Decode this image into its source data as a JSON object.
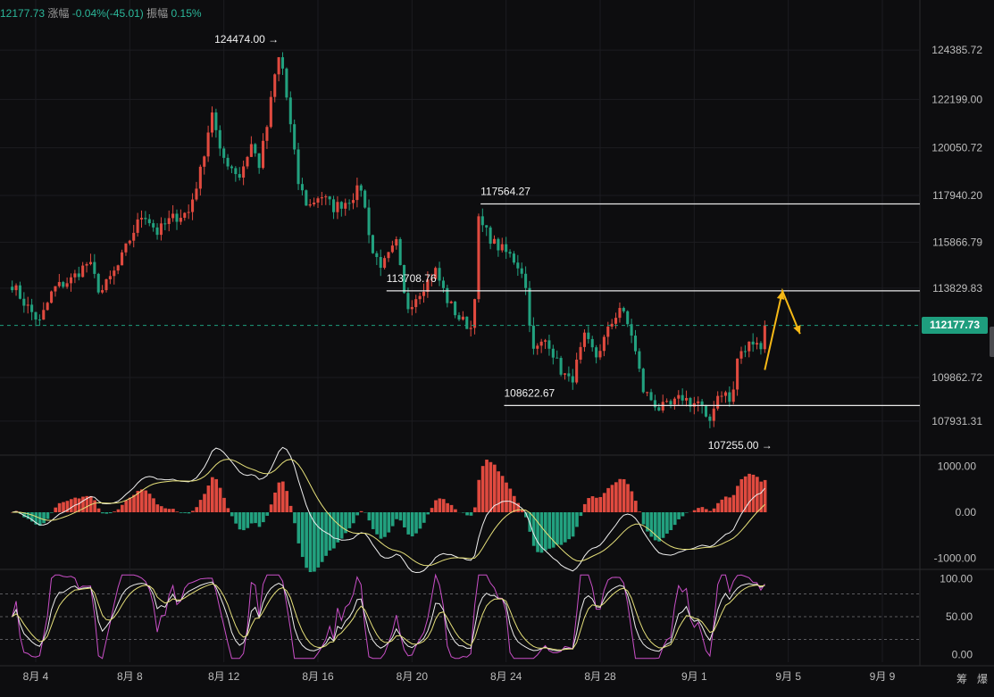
{
  "header": {
    "last_price": "12177.73",
    "change_label": "涨幅",
    "change_value": "-0.04%(-45.01)",
    "amplitude_label": "振幅",
    "amplitude_value": "0.15%"
  },
  "current_price_tag": "112177.73",
  "bottom_right": {
    "left": "筹",
    "right": "爆"
  },
  "colors": {
    "up": "#e04a3f",
    "down": "#22a17f",
    "background": "#0d0d0f",
    "grid": "#1c1c20",
    "accent_arrow": "#f5b816",
    "price_tag": "#1e9e7e",
    "stoch_k": "#c94fc7",
    "stoch_d": "#e6e07a"
  },
  "chart_data": [
    {
      "type": "candlestick",
      "panel": "price",
      "x_ticks": [
        "8月 4",
        "8月 8",
        "8月 12",
        "8月 16",
        "8月 20",
        "8月 24",
        "8月 28",
        "9月 1",
        "9月 5",
        "9月 9"
      ],
      "y_ticks": [
        124385.72,
        122199.0,
        120050.72,
        117940.2,
        115866.79,
        113829.83,
        109862.72,
        107931.31
      ],
      "ylim": [
        106500,
        125500
      ],
      "xlim_days": [
        "Aug 3",
        "Sep 10"
      ],
      "keypoints": [
        {
          "t": "Aug 3 00:00",
          "p": 114000
        },
        {
          "t": "Aug 3 12:00",
          "p": 113200
        },
        {
          "t": "Aug 4 04:00",
          "p": 112300
        },
        {
          "t": "Aug 4 18:00",
          "p": 113800
        },
        {
          "t": "Aug 5 12:00",
          "p": 114200
        },
        {
          "t": "Aug 6 06:00",
          "p": 115000
        },
        {
          "t": "Aug 6 18:00",
          "p": 113600
        },
        {
          "t": "Aug 7 12:00",
          "p": 114800
        },
        {
          "t": "Aug 8 02:00",
          "p": 116200
        },
        {
          "t": "Aug 8 14:00",
          "p": 117200
        },
        {
          "t": "Aug 9 04:00",
          "p": 116300
        },
        {
          "t": "Aug 9 18:00",
          "p": 116900
        },
        {
          "t": "Aug 10 12:00",
          "p": 117200
        },
        {
          "t": "Aug 11 00:00",
          "p": 119000
        },
        {
          "t": "Aug 11 12:00",
          "p": 121700
        },
        {
          "t": "Aug 11 20:00",
          "p": 119800
        },
        {
          "t": "Aug 12 16:00",
          "p": 118800
        },
        {
          "t": "Aug 13 04:00",
          "p": 120200
        },
        {
          "t": "Aug 13 12:00",
          "p": 119300
        },
        {
          "t": "Aug 13 20:00",
          "p": 121000
        },
        {
          "t": "Aug 14 06:00",
          "p": 123800
        },
        {
          "t": "Aug 14 10:00",
          "p": 124200
        },
        {
          "t": "Aug 14 20:00",
          "p": 121000
        },
        {
          "t": "Aug 15 04:00",
          "p": 118500
        },
        {
          "t": "Aug 15 14:00",
          "p": 117400
        },
        {
          "t": "Aug 16 02:00",
          "p": 118000
        },
        {
          "t": "Aug 16 16:00",
          "p": 117400
        },
        {
          "t": "Aug 17 06:00",
          "p": 117700
        },
        {
          "t": "Aug 17 20:00",
          "p": 118300
        },
        {
          "t": "Aug 18 08:00",
          "p": 115400
        },
        {
          "t": "Aug 18 18:00",
          "p": 114800
        },
        {
          "t": "Aug 19 08:00",
          "p": 115800
        },
        {
          "t": "Aug 19 18:00",
          "p": 112900
        },
        {
          "t": "Aug 20 08:00",
          "p": 113700
        },
        {
          "t": "Aug 21 00:00",
          "p": 114600
        },
        {
          "t": "Aug 21 12:00",
          "p": 113300
        },
        {
          "t": "Aug 22 00:00",
          "p": 112500
        },
        {
          "t": "Aug 22 14:00",
          "p": 112000
        },
        {
          "t": "Aug 22 20:00",
          "p": 116800
        },
        {
          "t": "Aug 23 12:00",
          "p": 115800
        },
        {
          "t": "Aug 24 06:00",
          "p": 115200
        },
        {
          "t": "Aug 24 18:00",
          "p": 114500
        },
        {
          "t": "Aug 25 04:00",
          "p": 111000
        },
        {
          "t": "Aug 25 18:00",
          "p": 111600
        },
        {
          "t": "Aug 26 06:00",
          "p": 110300
        },
        {
          "t": "Aug 26 18:00",
          "p": 109600
        },
        {
          "t": "Aug 27 08:00",
          "p": 111600
        },
        {
          "t": "Aug 27 20:00",
          "p": 110800
        },
        {
          "t": "Aug 28 12:00",
          "p": 112300
        },
        {
          "t": "Aug 28 20:00",
          "p": 113000
        },
        {
          "t": "Aug 29 08:00",
          "p": 111800
        },
        {
          "t": "Aug 29 20:00",
          "p": 109300
        },
        {
          "t": "Aug 30 12:00",
          "p": 108500
        },
        {
          "t": "Aug 31 00:00",
          "p": 108600
        },
        {
          "t": "Aug 31 12:00",
          "p": 109000
        },
        {
          "t": "Aug 31 22:00",
          "p": 108700
        },
        {
          "t": "Sep 1 06:00",
          "p": 108800
        },
        {
          "t": "Sep 1 14:00",
          "p": 107600
        },
        {
          "t": "Sep 1 22:00",
          "p": 109000
        },
        {
          "t": "Sep 2 06:00",
          "p": 109300
        },
        {
          "t": "Sep 2 14:00",
          "p": 108600
        },
        {
          "t": "Sep 2 20:00",
          "p": 110700
        },
        {
          "t": "Sep 3 06:00",
          "p": 111200
        },
        {
          "t": "Sep 3 14:00",
          "p": 111700
        },
        {
          "t": "Sep 3 20:00",
          "p": 111100
        },
        {
          "t": "Sep 4 00:00",
          "p": 112177.73
        }
      ],
      "annotations": [
        {
          "label": "124474.00",
          "t": "Aug 14 08:00",
          "p": 124474.0,
          "arrow": "→"
        },
        {
          "label": "117564.27",
          "t": "Aug 22 22:00",
          "p": 117564.27
        },
        {
          "label": "113708.76",
          "t": "Aug 18 22:00",
          "p": 113708.76
        },
        {
          "label": "108622.67",
          "t": "Aug 23 22:00",
          "p": 108622.67
        },
        {
          "label": "107255.00",
          "t": "Sep 1 14:00",
          "p": 107255.0,
          "arrow": "→"
        }
      ],
      "horizontal_lines": [
        {
          "p": 117564.27,
          "from": "Aug 22 22:00",
          "to": "Sep 10"
        },
        {
          "p": 113708.76,
          "from": "Aug 18 22:00",
          "to": "Sep 10"
        },
        {
          "p": 108622.67,
          "from": "Aug 23 22:00",
          "to": "Sep 10"
        }
      ],
      "current_price_line": 112177.73,
      "forecast_path": [
        {
          "t": "Sep 4 00:00",
          "p": 110200
        },
        {
          "t": "Sep 4 18:00",
          "p": 113700
        },
        {
          "t": "Sep 5 12:00",
          "p": 111800
        }
      ]
    },
    {
      "type": "macd",
      "panel": "indicator-1",
      "y_ticks": [
        1000.0,
        0.0,
        -1000.0
      ],
      "ylim": [
        -1200,
        1200
      ]
    },
    {
      "type": "stochastic",
      "panel": "indicator-2",
      "y_ticks": [
        100.0,
        50.0,
        0.0
      ],
      "reference_levels": [
        80,
        50,
        20
      ],
      "ylim": [
        -10,
        110
      ]
    }
  ]
}
